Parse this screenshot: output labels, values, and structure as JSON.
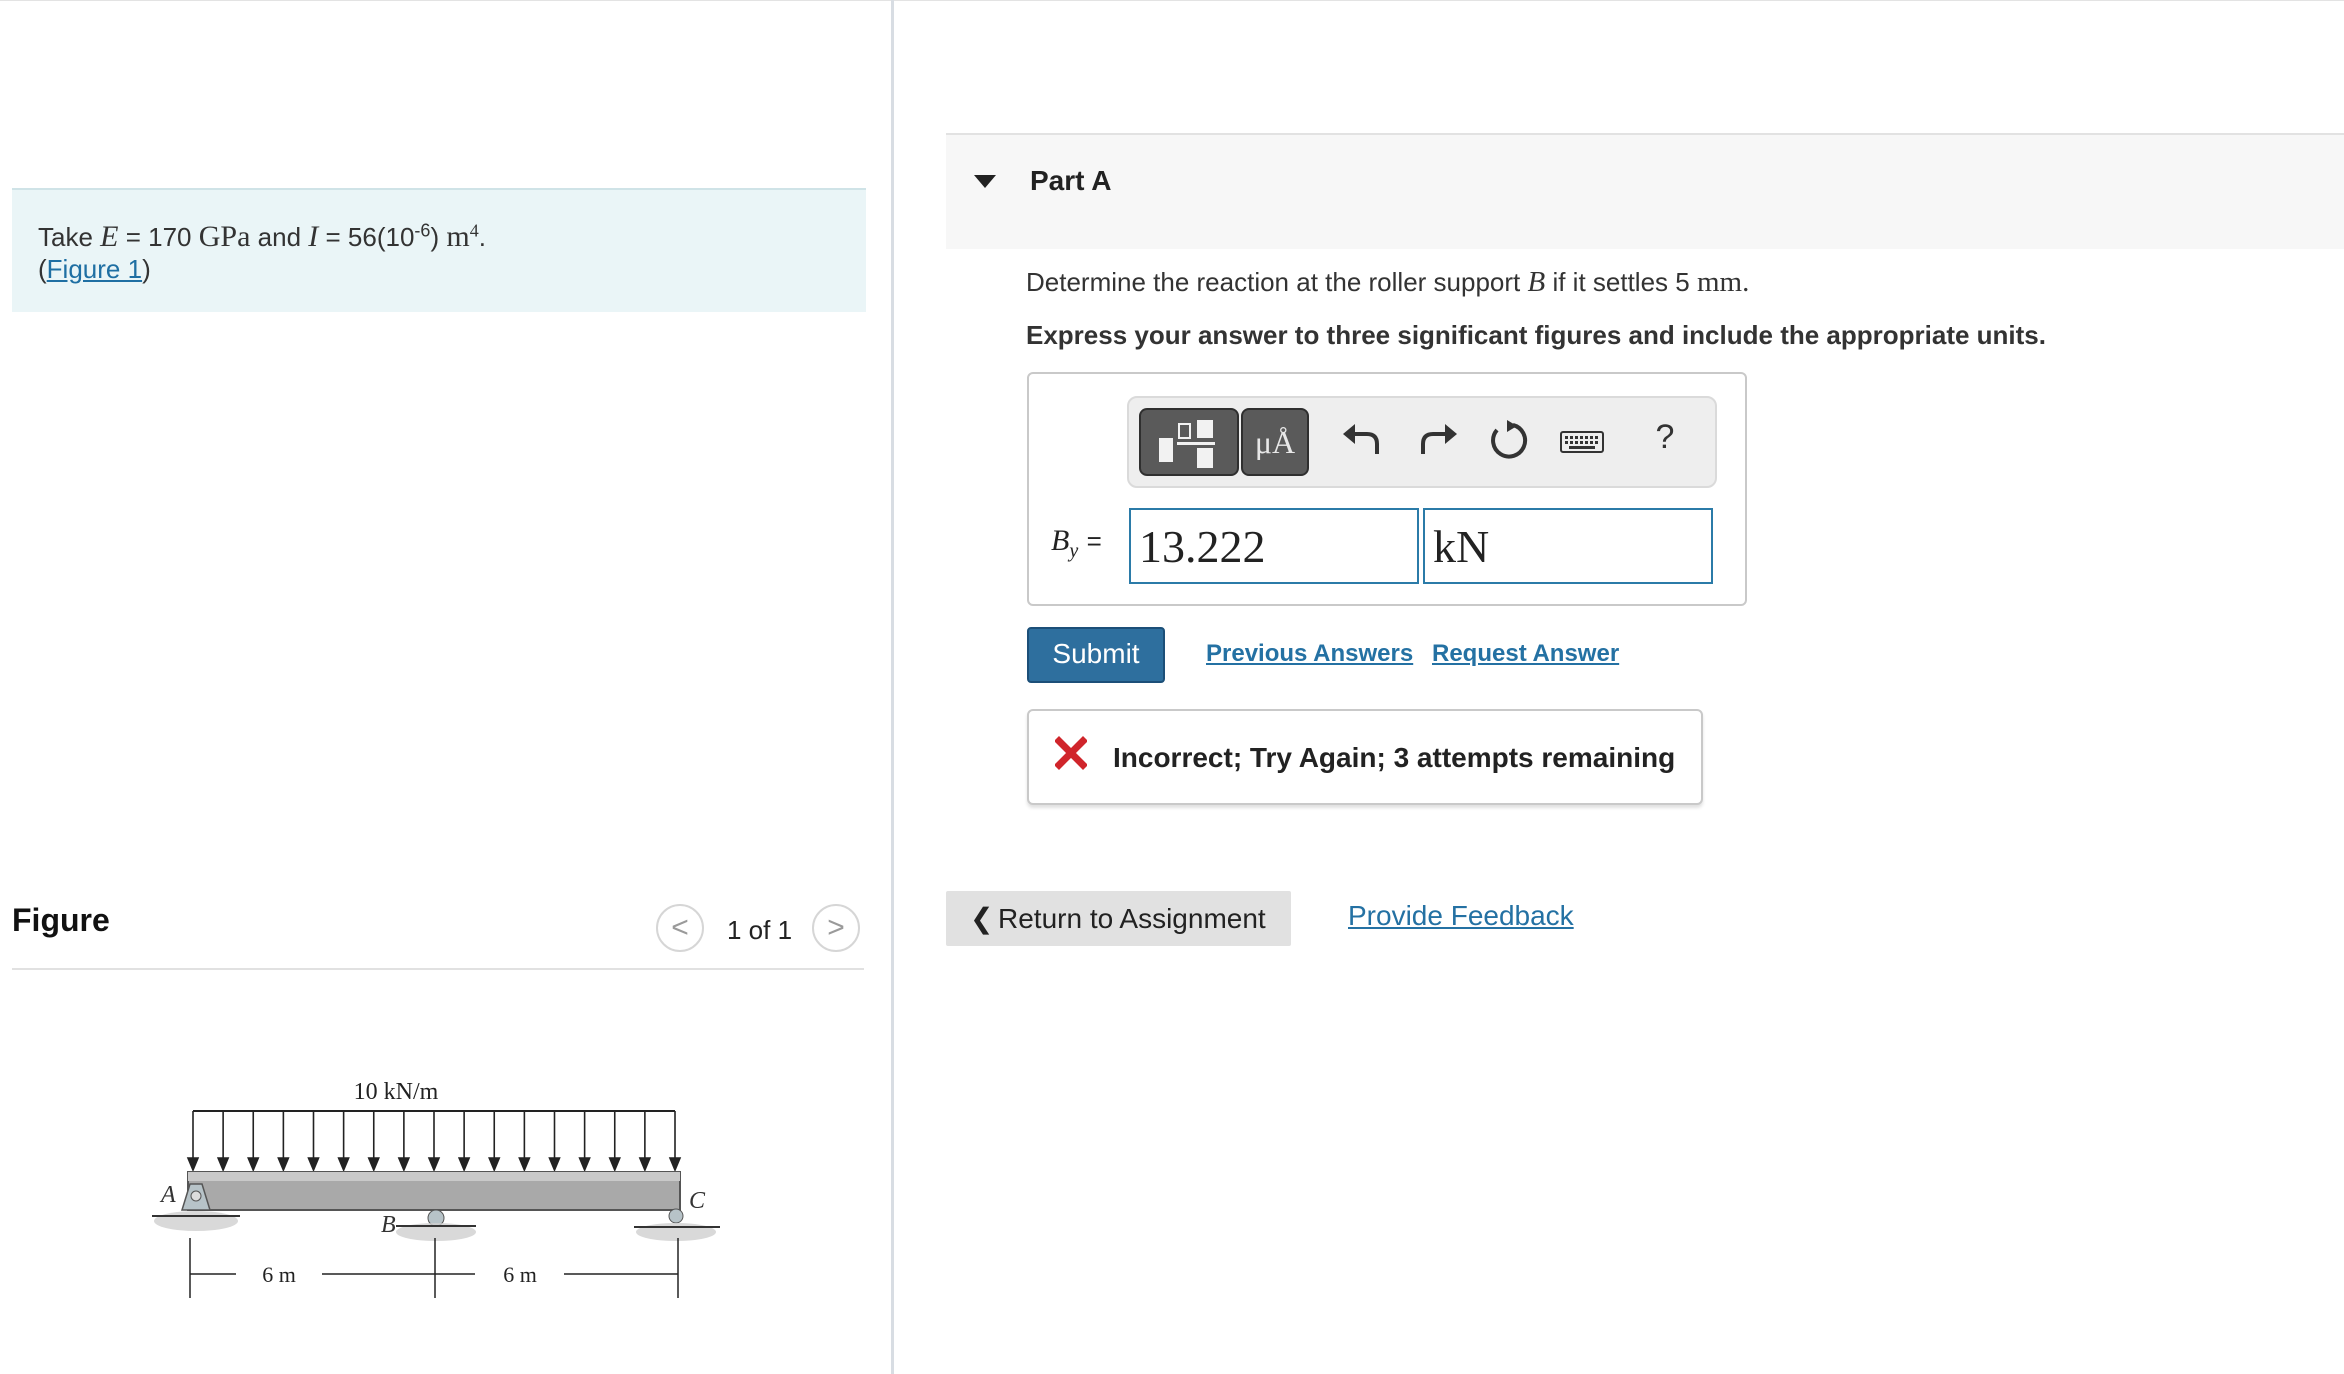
{
  "problem": {
    "take_prefix": "Take",
    "E_symbol": "E",
    "eq1": "= 170",
    "E_unit": "GPa",
    "and_text": "and",
    "I_symbol": "I",
    "eq2": "= 56(10",
    "exp1": "-6",
    "close_paren": ")",
    "I_unit": "m",
    "exp2": "4",
    "period": ".",
    "open_paren": "(",
    "figure_link": "Figure 1",
    "close_paren2": ")"
  },
  "figure_panel": {
    "title": "Figure",
    "pager_prev": "<",
    "pager_text": "1 of 1",
    "pager_next": ">",
    "beam": {
      "load_label": "10 kN/m",
      "support_a": "A",
      "support_b": "B",
      "support_c": "C",
      "span1": "6 m",
      "span2": "6 m"
    }
  },
  "part": {
    "title": "Part A",
    "question_prefix": "Determine the reaction at the roller support",
    "question_var": "B",
    "question_mid": "if it settles 5",
    "question_unit": "mm.",
    "instruction": "Express your answer to three significant figures and include the appropriate units."
  },
  "toolbar": {
    "units_label": "μÅ",
    "help_label": "?"
  },
  "answer": {
    "var_base": "B",
    "var_sub": "y",
    "equals": "=",
    "value": "13.222",
    "unit": "kN"
  },
  "actions": {
    "submit": "Submit",
    "previous_answers": "Previous Answers",
    "request_answer": "Request Answer"
  },
  "feedback": {
    "message": "Incorrect; Try Again; 3 attempts remaining",
    "status_color": "#d0252b"
  },
  "footer": {
    "return_chevron": "❮",
    "return_label": "Return to Assignment",
    "provide_feedback": "Provide Feedback"
  }
}
